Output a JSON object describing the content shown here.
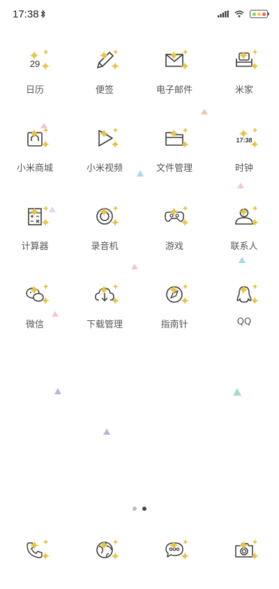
{
  "status_bar": {
    "time": "17:38",
    "colors": {
      "battery_green": "#7ed957",
      "battery_red": "#ff5a5a",
      "battery_yellow": "#ffc83d"
    }
  },
  "apps": [
    {
      "name": "calendar",
      "label": "日历",
      "icon_text": "29"
    },
    {
      "name": "notes",
      "label": "便签"
    },
    {
      "name": "email",
      "label": "电子邮件"
    },
    {
      "name": "mijia",
      "label": "米家"
    },
    {
      "name": "mi-store",
      "label": "小米商城"
    },
    {
      "name": "mi-video",
      "label": "小米视频"
    },
    {
      "name": "file-manager",
      "label": "文件管理"
    },
    {
      "name": "clock",
      "label": "时钟",
      "icon_text": "17:38"
    },
    {
      "name": "calculator",
      "label": "计算器"
    },
    {
      "name": "recorder",
      "label": "录音机"
    },
    {
      "name": "games",
      "label": "游戏"
    },
    {
      "name": "contacts",
      "label": "联系人"
    },
    {
      "name": "wechat",
      "label": "微信"
    },
    {
      "name": "downloads",
      "label": "下载管理"
    },
    {
      "name": "compass",
      "label": "指南针"
    },
    {
      "name": "qq",
      "label": "QQ"
    }
  ],
  "dock": [
    {
      "name": "phone",
      "icon": "phone-icon"
    },
    {
      "name": "browser",
      "icon": "globe-icon"
    },
    {
      "name": "messages",
      "icon": "chat-bubble-icon"
    },
    {
      "name": "camera",
      "icon": "camera-icon"
    }
  ],
  "pager": {
    "pages": 2,
    "current": 2
  },
  "theme": {
    "line_color": "#3a3a3a",
    "sparkle_color": "#e6c44a",
    "label_color": "#555555"
  }
}
